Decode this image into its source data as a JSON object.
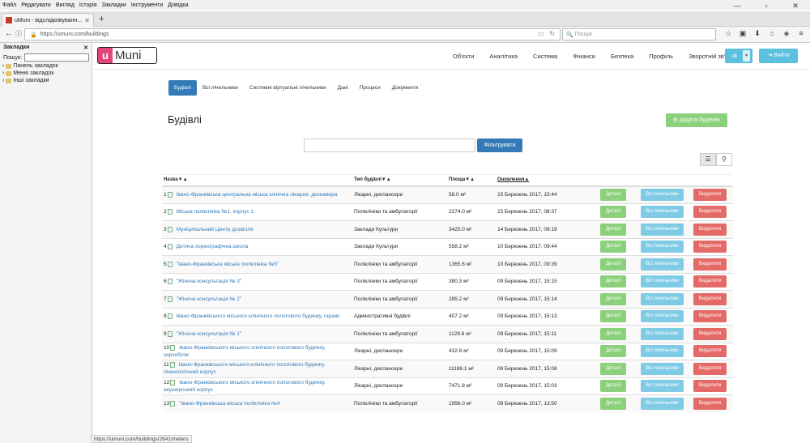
{
  "os_menu": [
    "Файл",
    "Редагувати",
    "Вигляд",
    "Історія",
    "Закладки",
    "Інструменти",
    "Довідка"
  ],
  "browser": {
    "tab_title": "uMuni - відслідковуванн...",
    "url": "https://umuni.com/buildings",
    "search_placeholder": "Пошук",
    "status_url": "https://umuni.com/buildings/2641/meters"
  },
  "sidebar": {
    "title": "Закладки",
    "search_label": "Пошук:",
    "items": [
      "Панель закладок",
      "Меню закладок",
      "Інші закладки"
    ]
  },
  "app": {
    "logo_u": "u",
    "logo_text": "Muni",
    "menu": [
      "Об'єкти",
      "Аналітика",
      "Система",
      "Фінанси",
      "Безпека",
      "Профіль",
      "Зворотній зв'язок"
    ],
    "lang": "uk",
    "logout": "Вийти",
    "subtabs": [
      "Будівлі",
      "Всі лічильники",
      "Системні віртуальні лічильники",
      "Дані",
      "Процеси",
      "Документи"
    ],
    "page_title": "Будівлі",
    "add_button": "додати будівлю",
    "filter_button": "Фільтрувати"
  },
  "table": {
    "headers": [
      "Назва▼▲",
      "Тип будівлі▼▲",
      "Площа▼▲",
      "Оновлення▲"
    ],
    "buttons": {
      "details": "Деталі",
      "meters": "Всі лічильники",
      "delete": "Видалити"
    },
    "rows": [
      {
        "n": "1",
        "name": "Івано-Франківська центральна міська клінічна лікарня, дезкамера",
        "type": "Лікарні, диспансери",
        "area": "58.0 м²",
        "updated": "15 Березень 2017, 15:44"
      },
      {
        "n": "2",
        "name": "Міська поліклініка №1, корпус 1",
        "type": "Поліклініки та амбулаторії",
        "area": "2274.0 м²",
        "updated": "15 Березень 2017, 08:37"
      },
      {
        "n": "3",
        "name": "Муніципальний Центр дозвілля",
        "type": "Заклади Культури",
        "area": "3425.0 м²",
        "updated": "14 Березень 2017, 09:19"
      },
      {
        "n": "4",
        "name": "Дитяча хореографічна школа",
        "type": "Заклади Культури",
        "area": "558.2 м²",
        "updated": "10 Березень 2017, 09:44"
      },
      {
        "n": "5",
        "name": "\"Івано-Франківська міська поліклініка №5\"",
        "type": "Поліклініки та амбулаторії",
        "area": "1365.6 м²",
        "updated": "10 Березень 2017, 09:39"
      },
      {
        "n": "6",
        "name": "\"Жіноча консультація № 3\"",
        "type": "Поліклініки та амбулаторії",
        "area": "380.3 м²",
        "updated": "09 Березень 2017, 15:15"
      },
      {
        "n": "7",
        "name": "\"Жіноча консультація № 2\"",
        "type": "Поліклініки та амбулаторії",
        "area": "285.2 м²",
        "updated": "09 Березень 2017, 15:14"
      },
      {
        "n": "8",
        "name": "Івано-Франківського міського клінічного пологового будинку, гаражі",
        "type": "Адміністративні будівлі",
        "area": "407.2 м²",
        "updated": "09 Березень 2017, 15:13"
      },
      {
        "n": "9",
        "name": "\"Жіноча консультація № 1\"",
        "type": "Поліклініки та амбулаторії",
        "area": "1129.6 м²",
        "updated": "09 Березень 2017, 15:11"
      },
      {
        "n": "10",
        "name": "Івано-Франківського міського клінічного пологового будинку, харчоблок",
        "type": "Лікарні, диспансери",
        "area": "432.8 м²",
        "updated": "09 Березень 2017, 15:09"
      },
      {
        "n": "11",
        "name": "Івано-Франківського міського клінічного пологового будинку, гінекологічний корпус",
        "type": "Лікарні, диспансери",
        "area": "11186.1 м²",
        "updated": "09 Березень 2017, 15:08"
      },
      {
        "n": "12",
        "name": "Івано-Франківського міського клінічного пологового будинку, акушерський корпус",
        "type": "Лікарні, диспансери",
        "area": "7471.8 м²",
        "updated": "09 Березень 2017, 15:03"
      },
      {
        "n": "13",
        "name": "\"Івано-Франківська міська поліклініка №4",
        "type": "Поліклініки та амбулаторії",
        "area": "1956.0 м²",
        "updated": "09 Березень 2017, 13:50"
      }
    ]
  }
}
